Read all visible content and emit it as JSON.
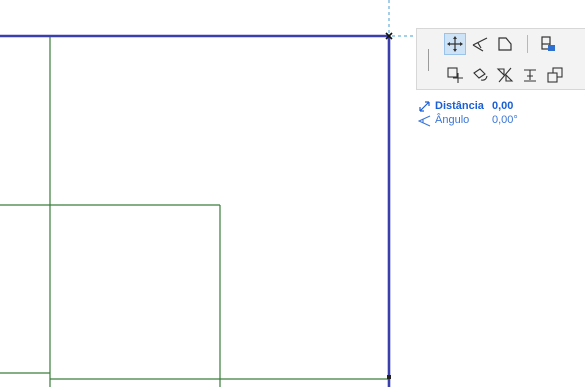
{
  "tracker": {
    "distance_label": "Distância",
    "distance_value": "0,00",
    "angle_label": "Ângulo",
    "angle_value": "0,00°"
  },
  "pet_palette": {
    "row1": [
      "move-icon",
      "angle-icon",
      "polygon-edit-icon",
      "divider",
      "stack-icon"
    ],
    "row2": [
      "copy-drag-icon",
      "rotate-icon",
      "mirror-icon",
      "elevate-icon",
      "multiply-icon"
    ],
    "selected": "move-icon"
  },
  "colors": {
    "wall_outline": "#3b3fae",
    "drawing_lines": "#3a7d3a",
    "guide_line": "#4a9fd6",
    "selection_fill": "#cfe3f6",
    "tracker_text": "#1b5fd6"
  }
}
